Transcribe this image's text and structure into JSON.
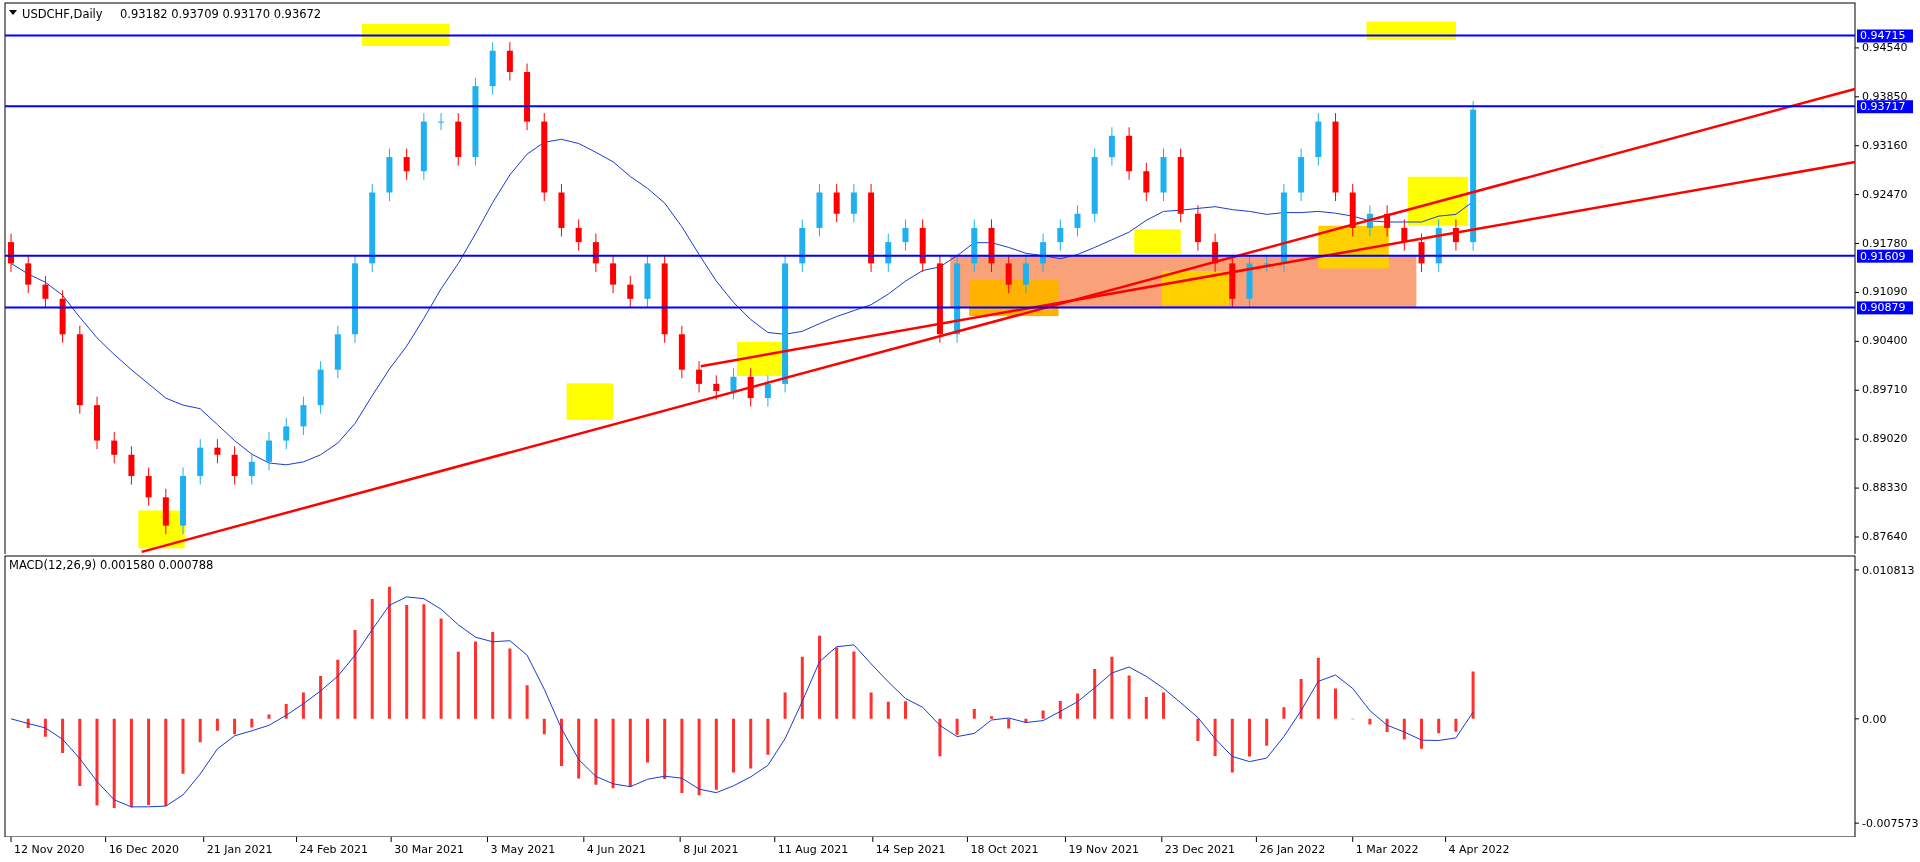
{
  "main_chart": {
    "title": "USDCHF,Daily",
    "quote": "0.93182 0.93709 0.93170 0.93672",
    "price_axis": [
      "0.94540",
      "0.93850",
      "0.93160",
      "0.92470",
      "0.91780",
      "0.91090",
      "0.90400",
      "0.89710",
      "0.89020",
      "0.88330",
      "0.87640"
    ],
    "price_tags": [
      "0.94715",
      "0.93717",
      "0.91609",
      "0.90879"
    ],
    "date_axis": [
      "12 Nov 2020",
      "16 Dec 2020",
      "21 Jan 2021",
      "24 Feb 2021",
      "30 Mar 2021",
      "3 May 2021",
      "4 Jun 2021",
      "8 Jul 2021",
      "11 Aug 2021",
      "14 Sep 2021",
      "18 Oct 2021",
      "19 Nov 2021",
      "23 Dec 2021",
      "26 Jan 2022",
      "1 Mar 2022",
      "4 Apr 2022"
    ]
  },
  "macd_chart": {
    "title": "MACD(12,26,9) 0.001580 0.000788",
    "axis": [
      "0.010813",
      "0.00",
      "-0.007573"
    ]
  }
}
